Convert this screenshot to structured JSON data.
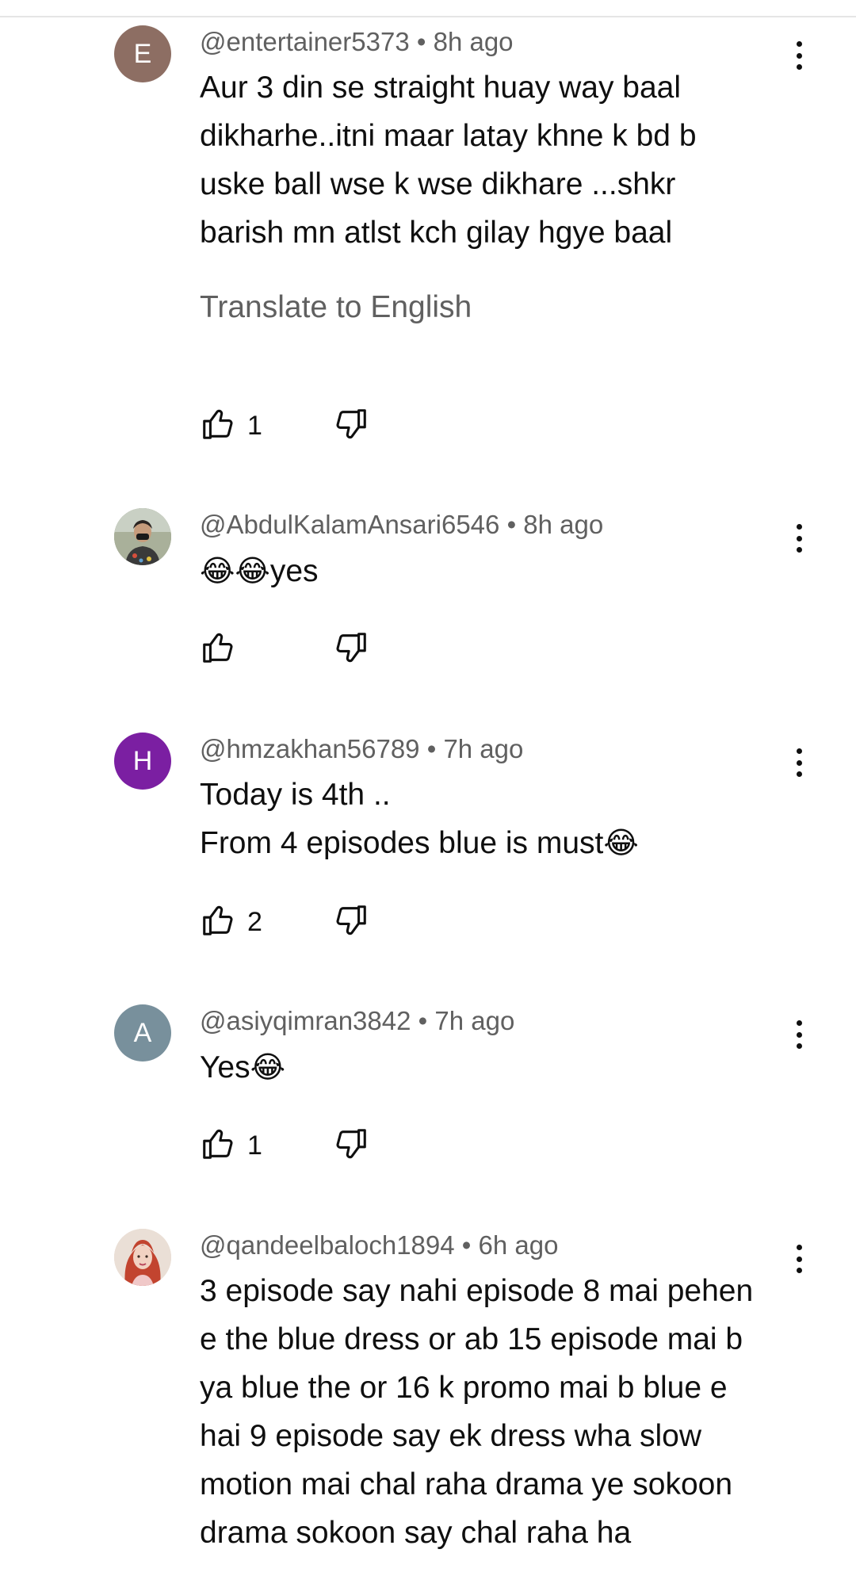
{
  "comments": [
    {
      "author": "@entertainer5373",
      "time": "8h ago",
      "avatar_letter": "E",
      "avatar_color": "#8d6e63",
      "lines": [
        "Aur 3 din se straight huay way baal",
        "dikharhe..itni maar latay khne k bd b",
        "uske ball wse k wse dikhare ...shkr",
        "barish mn atlst kch gilay hgye baal"
      ],
      "translate": "Translate to English",
      "likes": "1"
    },
    {
      "author": "@AbdulKalamAnsari6546",
      "time": "8h ago",
      "avatar_letter": "",
      "avatar_color": "#8a8f7a",
      "emoji": "😂😂",
      "text": "yes",
      "likes": ""
    },
    {
      "author": "@hmzakhan56789",
      "time": "7h ago",
      "avatar_letter": "H",
      "avatar_color": "#7b1fa2",
      "lines": [
        "Today is 4th ..",
        "From 4 episodes blue is must"
      ],
      "line2_emoji": "😂",
      "likes": "2"
    },
    {
      "author": "@asiyqimran3842",
      "time": "7h ago",
      "avatar_letter": "A",
      "avatar_color": "#78909c",
      "text": "Yes",
      "emoji": "😂",
      "likes": "1"
    },
    {
      "author": "@qandeelbaloch1894",
      "time": "6h ago",
      "avatar_letter": "",
      "avatar_color": "#e8d5c8",
      "lines": [
        "3 episode say nahi episode 8 mai pehen",
        "e the blue dress or ab 15 episode mai b",
        "ya blue the or 16 k promo mai b blue e",
        "hai 9 episode say ek dress wha slow",
        "motion mai chal raha drama ye sokoon",
        "drama sokoon say chal raha ha"
      ]
    }
  ],
  "separator": "•",
  "icons": {
    "like": "thumbs-up-icon",
    "dislike": "thumbs-down-icon",
    "more": "more-vertical-icon"
  }
}
